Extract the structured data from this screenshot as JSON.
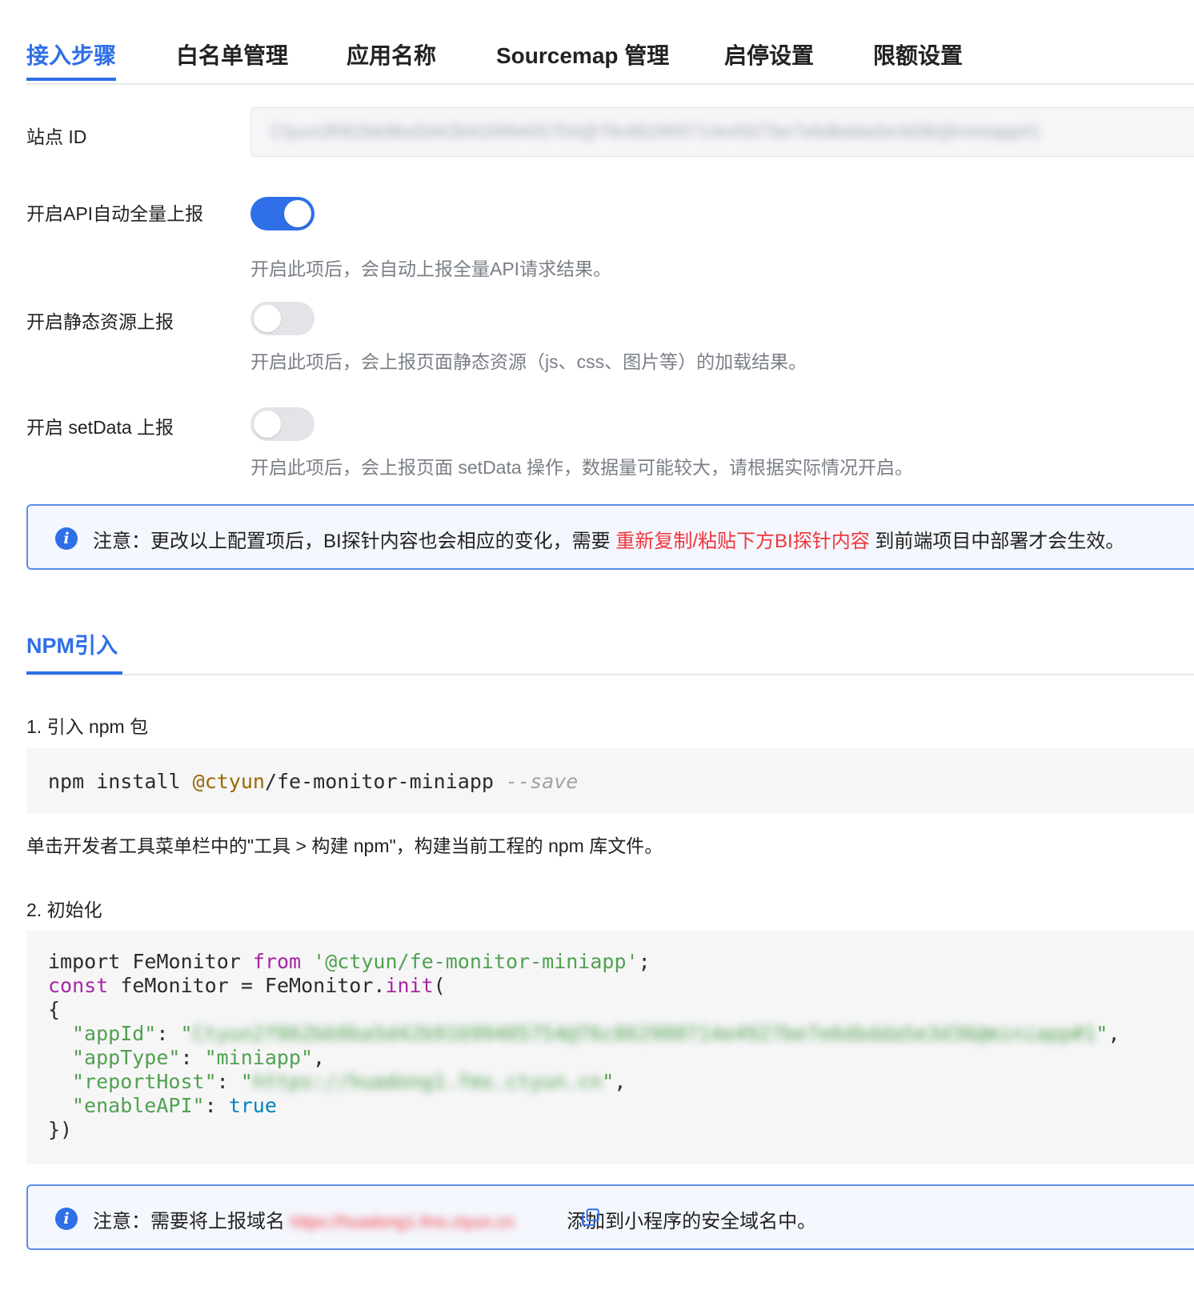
{
  "tabs": [
    {
      "label": "接入步骤",
      "active": true
    },
    {
      "label": "白名单管理",
      "active": false
    },
    {
      "label": "应用名称",
      "active": false
    },
    {
      "label": "Sourcemap 管理",
      "active": false
    },
    {
      "label": "启停设置",
      "active": false
    },
    {
      "label": "限额设置",
      "active": false
    }
  ],
  "form": {
    "site_id_label": "站点 ID",
    "site_id_value": "Ctyun2f062bb9ba5d42b91699405754@76c862900714e4927be7e6dbddaSe3d36@miniapp#1",
    "api_label": "开启API自动全量上报",
    "api_enabled": true,
    "api_hint": "开启此项后，会自动上报全量API请求结果。",
    "static_label": "开启静态资源上报",
    "static_enabled": false,
    "static_hint": "开启此项后，会上报页面静态资源（js、css、图片等）的加载结果。",
    "setdata_label": "开启 setData 上报",
    "setdata_enabled": false,
    "setdata_hint": "开启此项后，会上报页面 setData 操作，数据量可能较大，请根据实际情况开启。"
  },
  "notice1": {
    "prefix": "注意：更改以上配置项后，BI探针内容也会相应的变化，需要",
    "highlight": "重新复制/粘贴下方BI探针内容",
    "suffix": "到前端项目中部署才会生效。"
  },
  "npm_section": {
    "tab_label": "NPM引入",
    "step1_title": "1. 引入 npm 包",
    "install_cmd": "npm install",
    "install_scope": "@ctyun",
    "install_pkg": "/fe-monitor-miniapp",
    "install_flag": "--save",
    "step1_desc": "单击开发者工具菜单栏中的\"工具 > 构建 npm\"，构建当前工程的 npm 库文件。",
    "step2_title": "2. 初始化",
    "code": {
      "import_kw": "import",
      "import_name": " FeMonitor ",
      "from_kw": "from",
      "import_src": "'@ctyun/fe-monitor-miniapp'",
      "semicolon": ";",
      "const_kw": "const",
      "const_rest": " feMonitor = FeMonitor.",
      "init_fn": "init",
      "open_paren": "(",
      "open_brace": "{",
      "appid_key": "\"appId\"",
      "appid_value": "Ctyun2f062bb9ba5d42b91699405754@76c862900714e4927be7e6dbddaSe3d36@miniapp#1",
      "apptype_key": "\"appType\"",
      "apptype_value": "\"miniapp\"",
      "reporthost_key": "\"reportHost\"",
      "reporthost_value": "https://huadong1.fms.ctyun.cn",
      "enableapi_key": "\"enableAPI\"",
      "enableapi_value": "true",
      "close": "})"
    }
  },
  "notice2": {
    "prefix": "注意：需要将上报域名",
    "domain": "https://huadong1.fms.ctyun.cn",
    "suffix": "添加到小程序的安全域名中。"
  },
  "colors": {
    "accent": "#2f6fe8",
    "highlight_red": "#f0353c",
    "notice_bg": "#f4f7fd",
    "code_bg": "#f6f6f7"
  }
}
